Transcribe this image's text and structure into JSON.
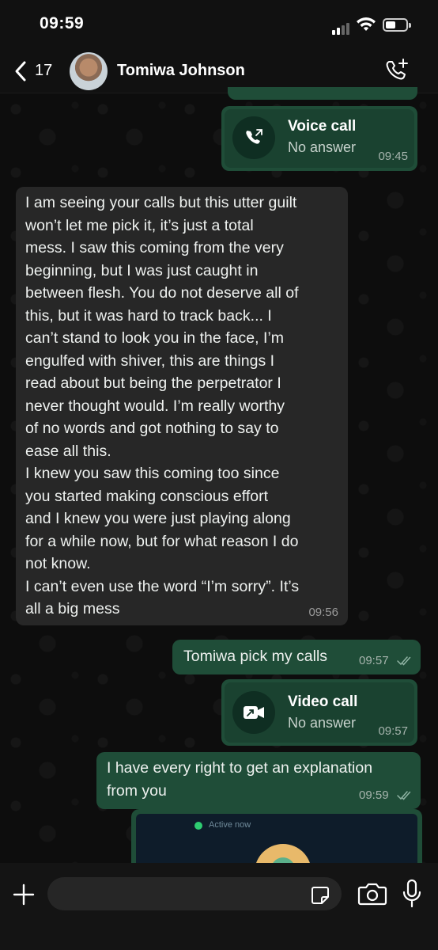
{
  "status_bar": {
    "time": "09:59"
  },
  "header": {
    "back_count": "17",
    "contact_name": "Tomiwa Johnson"
  },
  "messages": [
    {
      "type": "call",
      "direction": "outgoing",
      "title": "Voice call",
      "status": "No answer",
      "time": "09:45",
      "icon": "phone-missed-icon"
    },
    {
      "type": "text",
      "direction": "incoming",
      "text": "I am seeing your calls but this utter guilt\nwon’t let me pick it, it’s just a total\nmess. I saw this coming from the very\nbeginning, but I was just caught in\nbetween flesh. You do not deserve all of\nthis, but it was hard to track back... I\ncan’t stand to look you in the face, I’m\nengulfed with shiver, this are things I\nread about but being the perpetrator I\nnever thought would. I’m really worthy\nof no words and got nothing to say to\nease all this.\nI knew you saw this coming too since\nyou started making conscious effort\nand I knew you were just playing along\nfor a while now, but for what reason I do\nnot know.\nI can’t even use the word “I’m sorry”. It’s\nall a big mess",
      "time": "09:56"
    },
    {
      "type": "text",
      "direction": "outgoing",
      "text": "Tomiwa pick my calls",
      "time": "09:57",
      "read": true
    },
    {
      "type": "call",
      "direction": "outgoing",
      "title": "Video call",
      "status": "No answer",
      "time": "09:57",
      "icon": "video-missed-icon"
    },
    {
      "type": "text",
      "direction": "outgoing",
      "text": "I have every right to get an explanation\nfrom you",
      "time": "09:59",
      "read": true
    },
    {
      "type": "image",
      "direction": "outgoing",
      "preview_status": "Active now"
    }
  ],
  "composer": {
    "placeholder": ""
  },
  "colors": {
    "outgoing_bubble": "#1f4d38",
    "incoming_bubble": "#272727",
    "background": "#0d0d0d",
    "read_ticks": "#8fb3a3"
  }
}
